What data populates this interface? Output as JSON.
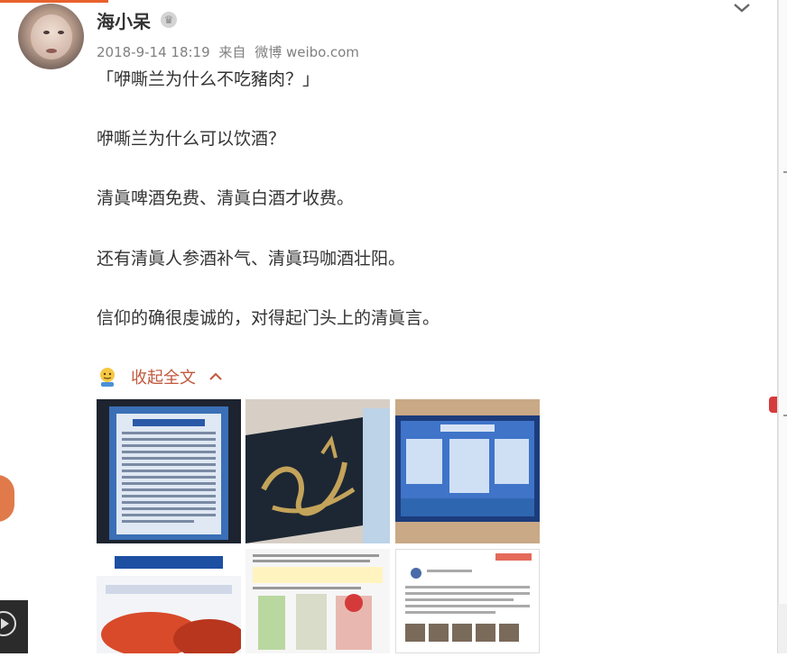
{
  "post": {
    "username": "海小呆",
    "meta": {
      "date": "2018-9-14 18:19",
      "source_prefix": "来自",
      "source": "微博 weibo.com"
    },
    "lines": [
      "「咿嘶兰为什么不吃豬肉？」",
      "咿嘶兰为什么可以饮酒？",
      "清眞啤酒免费、清眞白酒才收费。",
      "还有清眞人参酒补气、清眞玛咖酒壮阳。",
      "信仰的确很虔诚的，对得起门头上的清眞言。"
    ],
    "collapse_label": "收起全文"
  },
  "images": [
    {
      "name": "sign-board-photo"
    },
    {
      "name": "calligraphy-photo"
    },
    {
      "name": "wall-poster-photo"
    },
    {
      "name": "restaurant-sign-photo"
    },
    {
      "name": "liquor-bottles-screenshot"
    },
    {
      "name": "chat-screenshot"
    }
  ],
  "icons": {
    "crown": "crown-icon",
    "chevron_down": "chevron-down-icon",
    "emoji": "doge-emoji-icon",
    "chevron_up": "chevron-up-icon"
  },
  "colors": {
    "accent": "#c0593d",
    "meta_text": "#808080",
    "body_text": "#333333"
  }
}
